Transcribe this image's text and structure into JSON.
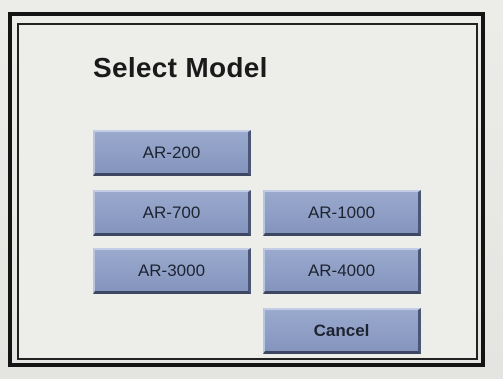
{
  "dialog": {
    "title": "Select Model"
  },
  "models": {
    "ar200": "AR-200",
    "ar700": "AR-700",
    "ar1000": "AR-1000",
    "ar3000": "AR-3000",
    "ar4000": "AR-4000"
  },
  "actions": {
    "cancel": "Cancel"
  },
  "colors": {
    "button_fill": "#8d9dc4",
    "frame": "#141414",
    "background": "#ededea"
  }
}
